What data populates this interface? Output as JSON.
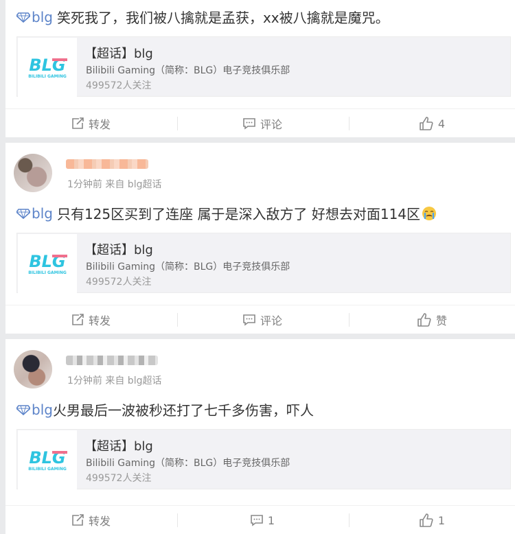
{
  "posts": [
    {
      "topic_tag": "blg",
      "text": "笑死我了，我们被八擒就是孟获，xx被八擒就是魔咒。",
      "share_card": {
        "logo_text": "BLG",
        "logo_subtext": "BILIBILI GAMING",
        "title": "【超话】blg",
        "description": "Bilibili Gaming（简称：BLG）电子竞技俱乐部",
        "followers": "499572人关注"
      },
      "actions": {
        "repost": "转发",
        "comment": "评论",
        "like": "4"
      }
    },
    {
      "meta": "1分钟前 来自 blg超话",
      "topic_tag": "blg",
      "text": "只有125区买到了连座 属于是深入敌方了 好想去对面114区",
      "share_card": {
        "logo_text": "BLG",
        "logo_subtext": "BILIBILI GAMING",
        "title": "【超话】blg",
        "description": "Bilibili Gaming（简称：BLG）电子竞技俱乐部",
        "followers": "499572人关注"
      },
      "actions": {
        "repost": "转发",
        "comment": "评论",
        "like": "赞"
      }
    },
    {
      "meta": "1分钟前 来自 blg超话",
      "topic_tag": "blg",
      "text": "火男最后一波被秒还打了七千多伤害，吓人",
      "share_card": {
        "logo_text": "BLG",
        "logo_subtext": "BILIBILI GAMING",
        "title": "【超话】blg",
        "description": "Bilibili Gaming（简称：BLG）电子竞技俱乐部",
        "followers": "499572人关注"
      },
      "actions": {
        "repost": "转发",
        "comment": "1",
        "like": "1"
      }
    }
  ],
  "colors": {
    "topic_link": "#5d84c9",
    "logo_cyan": "#2ec4e0",
    "logo_pink": "#f06f8c",
    "action_gray": "#808080"
  },
  "icons": [
    "topic-diamond-icon",
    "repost-icon",
    "comment-icon",
    "like-icon",
    "crying-emoji-icon"
  ]
}
